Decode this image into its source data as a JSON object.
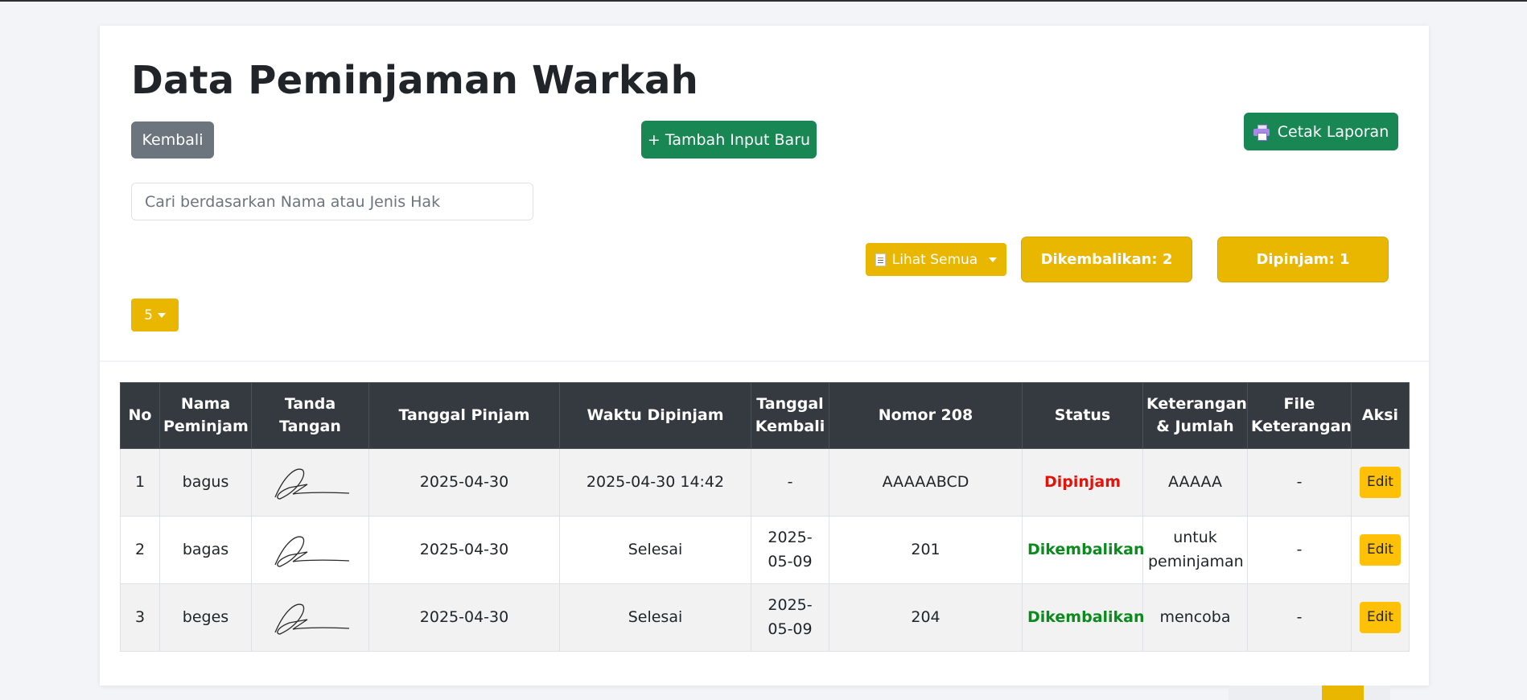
{
  "header": {
    "title": "Data Peminjaman Warkah"
  },
  "toolbar": {
    "back_label": "Kembali",
    "add_label": "+ Tambah Input Baru",
    "print_label": "Cetak Laporan"
  },
  "search": {
    "placeholder": "Cari berdasarkan Nama atau Jenis Hak"
  },
  "filter": {
    "label": "Lihat Semua"
  },
  "summary": {
    "returned_label": "Dikembalikan: 2",
    "borrowed_label": "Dipinjam: 1"
  },
  "per_page": {
    "value": "5"
  },
  "table": {
    "headers": [
      "No",
      "Nama Peminjam",
      "Tanda Tangan",
      "Tanggal Pinjam",
      "Waktu Dipinjam",
      "Tanggal Kembali",
      "Nomor 208",
      "Status",
      "Keterangan & Jumlah",
      "File Keterangan",
      "Aksi"
    ],
    "rows": [
      {
        "no": "1",
        "nama": "bagus",
        "tanggal_pinjam": "2025-04-30",
        "waktu_dipinjam": "2025-04-30 14:42",
        "tanggal_kembali": "-",
        "nomor": "AAAAABCD",
        "status": "Dipinjam",
        "keterangan": "AAAAA",
        "file": "-",
        "aksi": "Edit"
      },
      {
        "no": "2",
        "nama": "bagas",
        "tanggal_pinjam": "2025-04-30",
        "waktu_dipinjam": "Selesai",
        "tanggal_kembali": "2025-05-09",
        "nomor": "201",
        "status": "Dikembalikan",
        "keterangan": "untuk peminjaman",
        "file": "-",
        "aksi": "Edit"
      },
      {
        "no": "3",
        "nama": "beges",
        "tanggal_pinjam": "2025-04-30",
        "waktu_dipinjam": "Selesai",
        "tanggal_kembali": "2025-05-09",
        "nomor": "204",
        "status": "Dikembalikan",
        "keterangan": "mencoba",
        "file": "-",
        "aksi": "Edit"
      }
    ]
  },
  "icons": {
    "print": "printer-icon",
    "filter": "document-icon",
    "dropdown": "caret-down-icon"
  },
  "colors": {
    "success": "#198754",
    "secondary": "#6c757d",
    "warning": "#e9b600",
    "danger": "#e3120b",
    "returned": "#0b8a1e",
    "table_header": "#343a40"
  }
}
